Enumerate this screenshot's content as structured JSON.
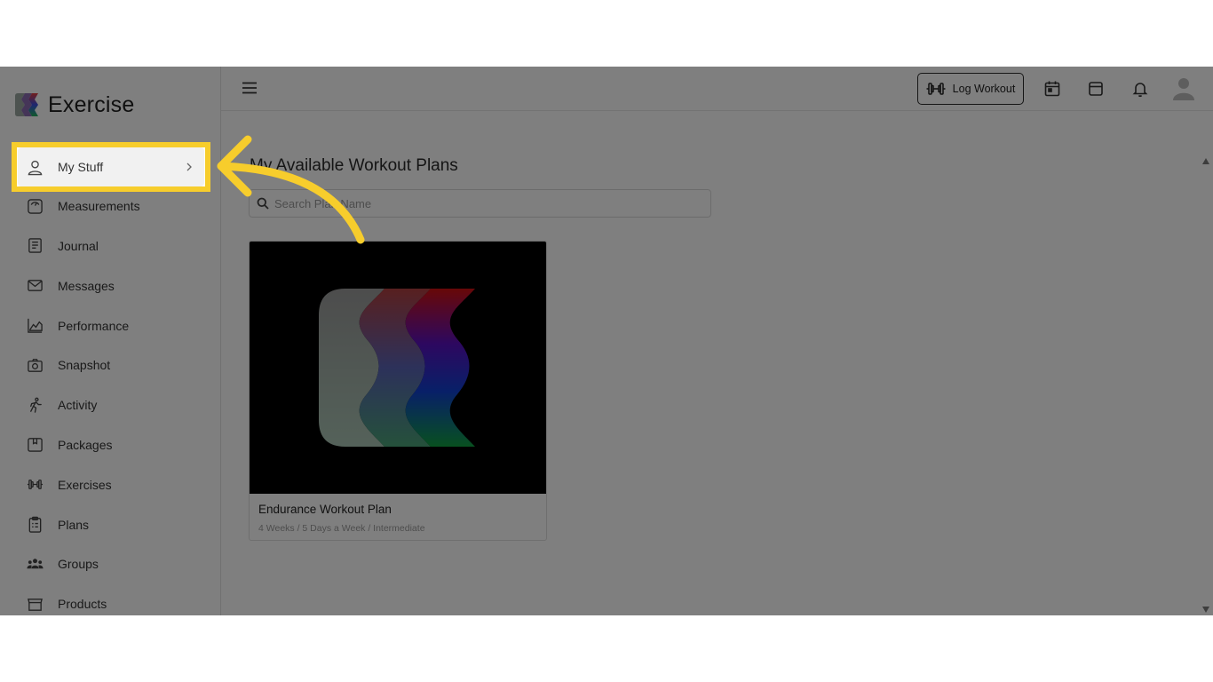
{
  "app": {
    "brand_name": "Exercise",
    "logo_icon": "exercise-logo-icon"
  },
  "sidebar": {
    "items": [
      {
        "label": "My Stuff",
        "icon": "user-icon",
        "active": true
      },
      {
        "label": "Measurements",
        "icon": "scale-icon"
      },
      {
        "label": "Journal",
        "icon": "journal-icon"
      },
      {
        "label": "Messages",
        "icon": "mail-icon"
      },
      {
        "label": "Performance",
        "icon": "chart-icon"
      },
      {
        "label": "Snapshot",
        "icon": "camera-icon"
      },
      {
        "label": "Activity",
        "icon": "running-icon"
      },
      {
        "label": "Packages",
        "icon": "package-icon"
      },
      {
        "label": "Exercises",
        "icon": "dumbbell-icon"
      },
      {
        "label": "Plans",
        "icon": "clipboard-icon"
      },
      {
        "label": "Groups",
        "icon": "groups-icon"
      },
      {
        "label": "Products",
        "icon": "store-icon"
      }
    ]
  },
  "topbar": {
    "log_workout_label": "Log Workout",
    "icons": [
      "menu-icon",
      "dumbbell-icon",
      "calendar-icon",
      "store-icon",
      "bell-icon",
      "avatar-icon"
    ]
  },
  "main": {
    "title": "My Available Workout Plans",
    "search_placeholder": "Search Plan Name",
    "plans": [
      {
        "title": "Endurance Workout Plan",
        "subtitle": "4 Weeks / 5 Days a Week / Intermediate"
      }
    ]
  },
  "colors": {
    "highlight": "#f7cd2c",
    "overlay": "rgba(0,0,0,0.5)"
  }
}
